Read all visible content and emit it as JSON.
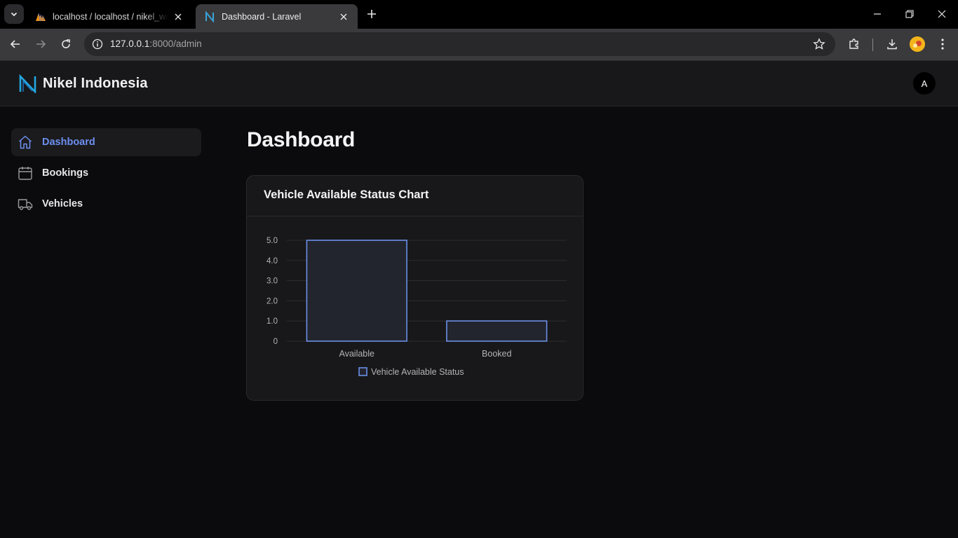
{
  "browser": {
    "tabs": [
      {
        "title": "localhost / localhost / nikel_web",
        "active": false,
        "icon": "phpmyadmin-icon"
      },
      {
        "title": "Dashboard - Laravel",
        "active": true,
        "icon": "laravel-n-icon"
      }
    ],
    "url_host": "127.0.0.1",
    "url_rest": ":8000/admin"
  },
  "header": {
    "brand": "Nikel Indonesia",
    "avatar_initial": "A"
  },
  "sidebar": {
    "items": [
      {
        "label": "Dashboard",
        "icon": "home-icon",
        "active": true
      },
      {
        "label": "Bookings",
        "icon": "calendar-icon",
        "active": false
      },
      {
        "label": "Vehicles",
        "icon": "truck-icon",
        "active": false
      }
    ]
  },
  "main": {
    "title": "Dashboard",
    "card_title": "Vehicle Available Status Chart"
  },
  "colors": {
    "accent": "#6d8ff0",
    "bar_fill": "#22252e",
    "bar_stroke": "#6b8fe6"
  },
  "chart_data": {
    "type": "bar",
    "categories": [
      "Available",
      "Booked"
    ],
    "series": [
      {
        "name": "Vehicle Available Status",
        "values": [
          5,
          1
        ]
      }
    ],
    "ylim": [
      0,
      5
    ],
    "yticks": [
      "0",
      "1.0",
      "2.0",
      "3.0",
      "4.0",
      "5.0"
    ],
    "legend_position": "bottom",
    "grid": true
  }
}
